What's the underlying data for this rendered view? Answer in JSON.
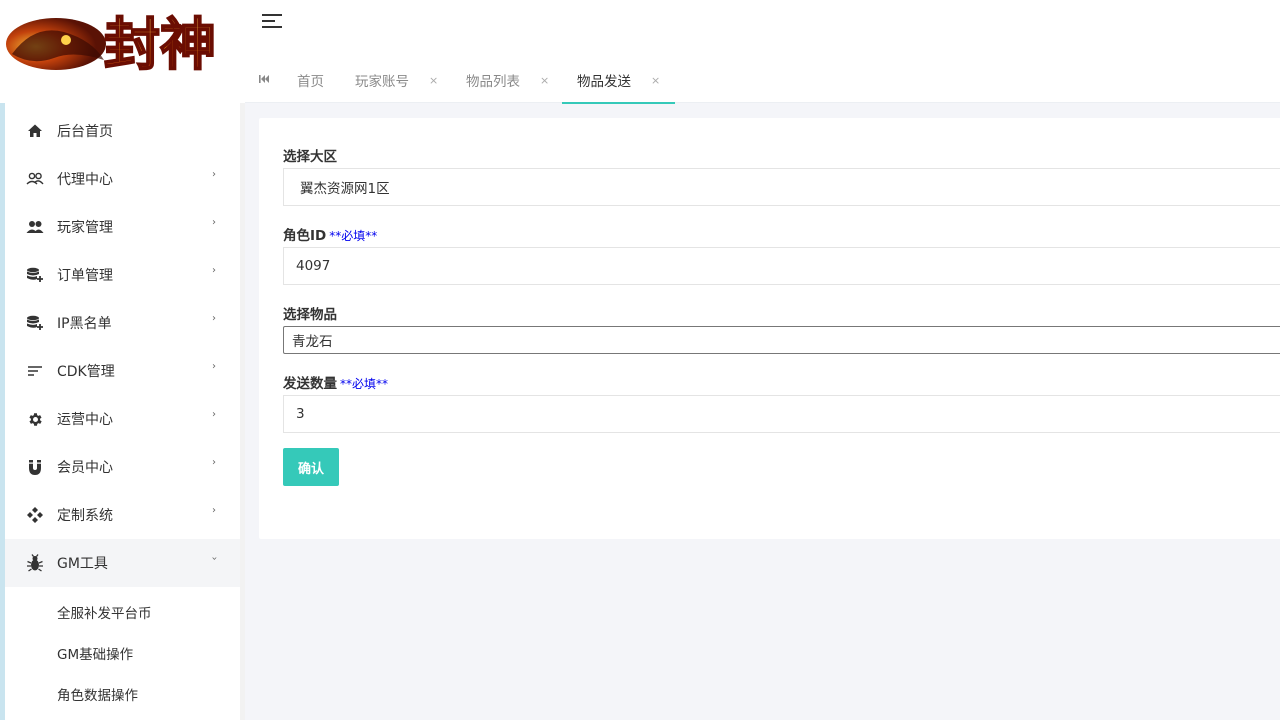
{
  "logo": {
    "text": "封神"
  },
  "sidebar": {
    "items": [
      {
        "label": "后台首页",
        "icon": "home-icon",
        "has_submenu": false
      },
      {
        "label": "代理中心",
        "icon": "users-outline-icon",
        "has_submenu": true
      },
      {
        "label": "玩家管理",
        "icon": "users-icon",
        "has_submenu": true
      },
      {
        "label": "订单管理",
        "icon": "database-add-icon",
        "has_submenu": true
      },
      {
        "label": "IP黑名单",
        "icon": "database-add-icon",
        "has_submenu": true
      },
      {
        "label": "CDK管理",
        "icon": "sort-lines-icon",
        "has_submenu": true
      },
      {
        "label": "运营中心",
        "icon": "gear-icon",
        "has_submenu": true
      },
      {
        "label": "会员中心",
        "icon": "magnet-icon",
        "has_submenu": true
      },
      {
        "label": "定制系统",
        "icon": "diamond-grid-icon",
        "has_submenu": true
      },
      {
        "label": "GM工具",
        "icon": "bug-icon",
        "has_submenu": true,
        "expanded": true
      }
    ],
    "sub_items": [
      {
        "label": "全服补发平台币"
      },
      {
        "label": "GM基础操作"
      },
      {
        "label": "角色数据操作"
      }
    ]
  },
  "tabs": [
    {
      "label": "首页",
      "closable": false
    },
    {
      "label": "玩家账号",
      "closable": true
    },
    {
      "label": "物品列表",
      "closable": true
    },
    {
      "label": "物品发送",
      "closable": true,
      "active": true
    }
  ],
  "tab_close_glyph": "×",
  "form": {
    "region_label": "选择大区",
    "region_value": "翼杰资源网1区",
    "role_id_label": "角色ID",
    "role_id_required": "**必填**",
    "role_id_value": "4097",
    "item_label": "选择物品",
    "item_value": "青龙石",
    "quantity_label": "发送数量",
    "quantity_required": "**必填**",
    "quantity_value": "3",
    "confirm_label": "确认"
  },
  "colors": {
    "accent": "#35c9b9",
    "required_text": "#0000ee"
  }
}
